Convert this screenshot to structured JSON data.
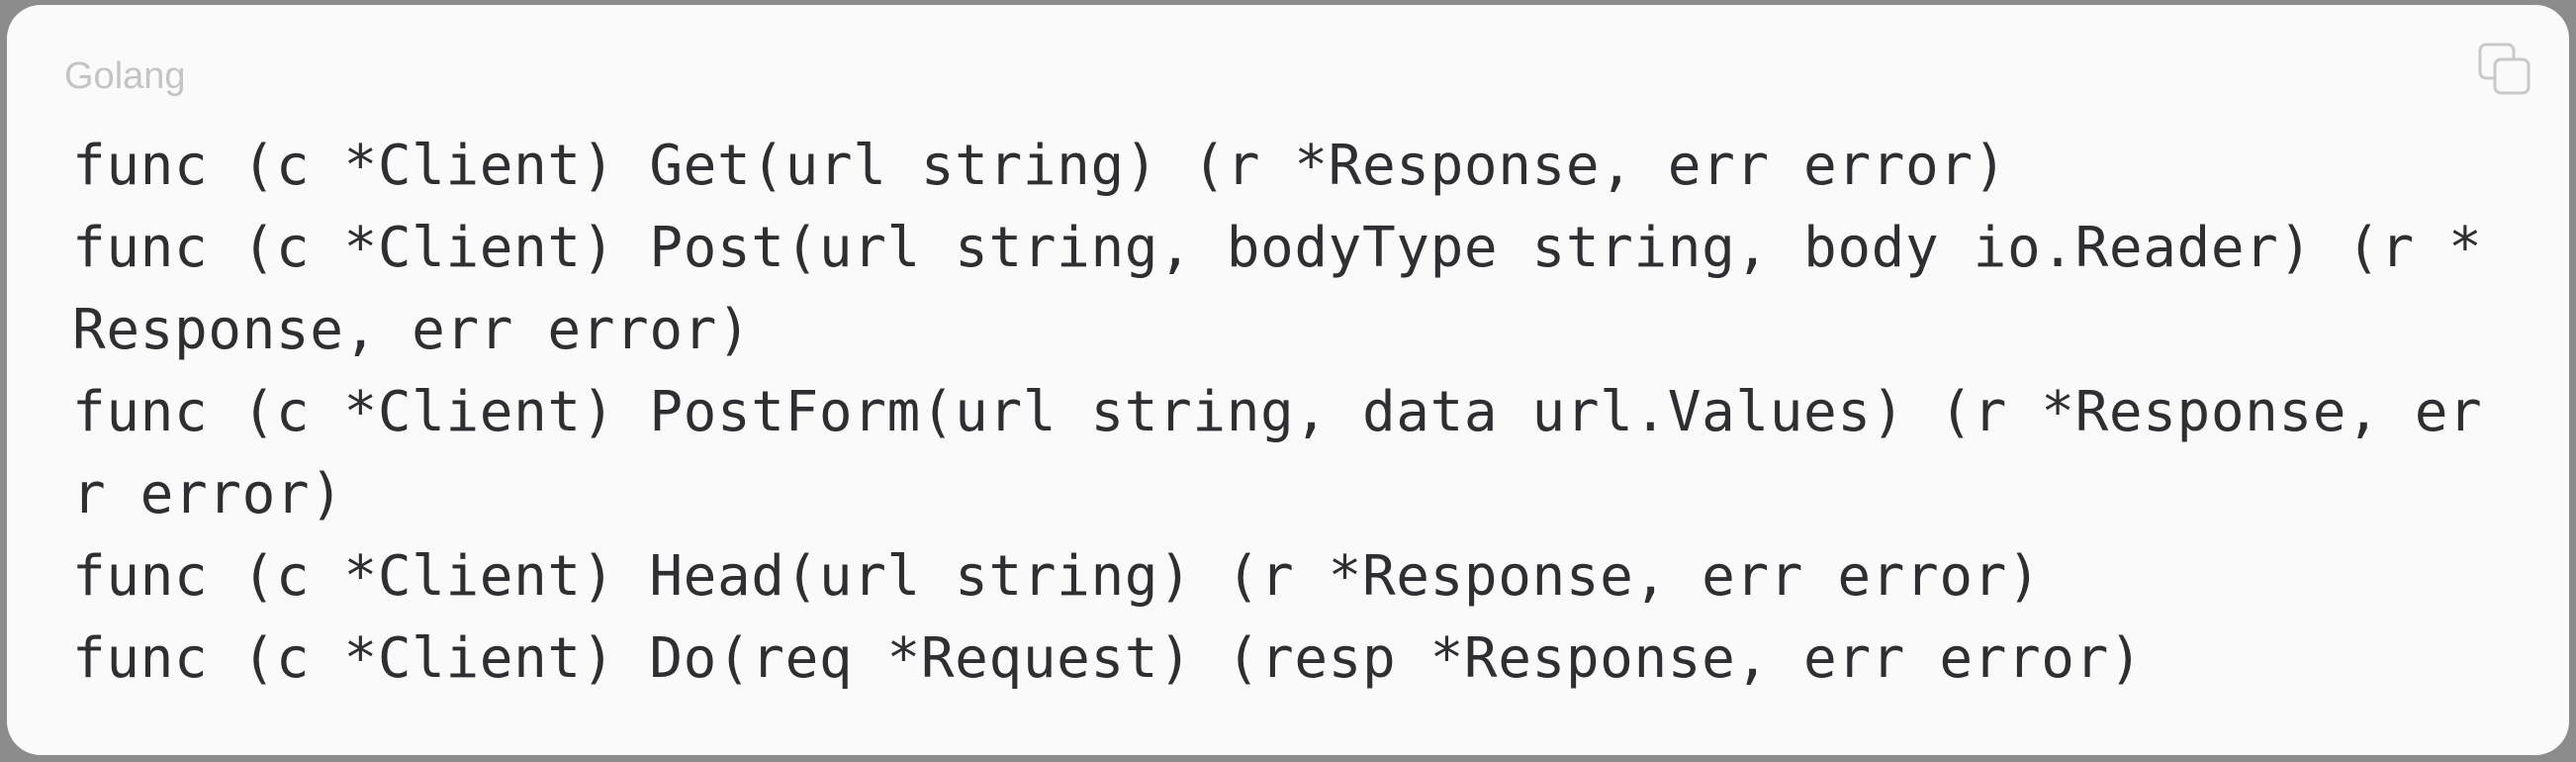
{
  "code_block": {
    "language_label": "Golang",
    "copy_icon": "copy-icon",
    "lines": [
      "func (c *Client) Get(url string) (r *Response, err error)",
      "func (c *Client) Post(url string, bodyType string, body io.Reader) (r *",
      "Response, err error)",
      "func (c *Client) PostForm(url string, data url.Values) (r *Response, er",
      "r error)",
      "func (c *Client) Head(url string) (r *Response, err error)",
      "func (c *Client) Do(req *Request) (resp *Response, err error)"
    ]
  },
  "colors": {
    "card_background": "#fafafa",
    "code_text": "#2f2f33",
    "label_text": "#c4c4c4",
    "backdrop": "#8c8c8c"
  }
}
